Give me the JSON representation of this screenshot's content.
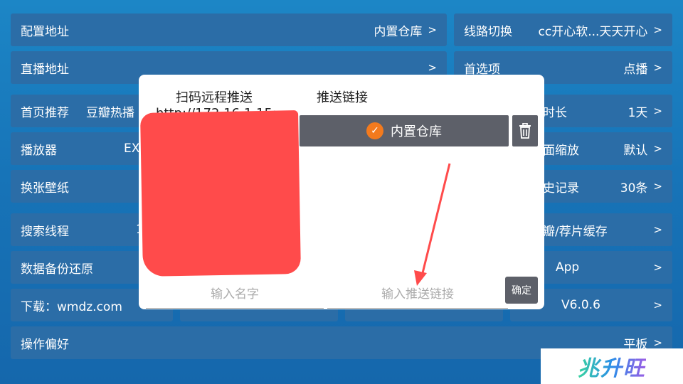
{
  "settings": {
    "config_address": {
      "label": "配置地址",
      "value": "内置仓库",
      "arrow": ">"
    },
    "line_switch": {
      "label": "线路切换",
      "value": "cc开心软...天天开心",
      "arrow": ">"
    },
    "live_address": {
      "label": "直播地址",
      "value": "",
      "arrow": ">"
    },
    "preferred": {
      "label": "首选项",
      "value": "点播",
      "arrow": ">"
    },
    "home_recommend": {
      "label": "首页推荐",
      "value": "豆瓣热播",
      "arrow": ">"
    },
    "duration": {
      "label": "时长",
      "value": "1天",
      "arrow": ">"
    },
    "player": {
      "label": "播放器",
      "value": "EX",
      "arrow": ">"
    },
    "scale": {
      "label": "面缩放",
      "value": "默认",
      "arrow": ">"
    },
    "wallpaper": {
      "label": "换张壁纸",
      "value": "",
      "arrow": ">"
    },
    "history": {
      "label": "史记录",
      "value": "30条",
      "arrow": ">"
    },
    "search_thread": {
      "label": "搜索线程",
      "value": "1",
      "arrow": ">"
    },
    "cache": {
      "label": "瓣/荐片缓存",
      "value": "",
      "arrow": ">"
    },
    "backup": {
      "label": "数据备份还原",
      "value": "",
      "arrow": ">"
    },
    "app": {
      "label": "App",
      "value": "",
      "arrow": ">"
    },
    "download": {
      "label": "下载：wmdz.com",
      "value": ""
    },
    "version": {
      "label": "",
      "value": "V6.0.6",
      "arrow": ">"
    },
    "operation": {
      "label": "操作偏好",
      "value": "平板",
      "arrow": ">"
    }
  },
  "dialog": {
    "qr_title": "扫码远程推送",
    "qr_url": "http://172.16.1.15:",
    "push_title": "推送链接",
    "repo_item": "内置仓库",
    "check_icon": "check-icon",
    "name_placeholder": "输入名字",
    "link_placeholder": "输入推送链接",
    "confirm": "确定"
  },
  "watermark": "兆升旺"
}
